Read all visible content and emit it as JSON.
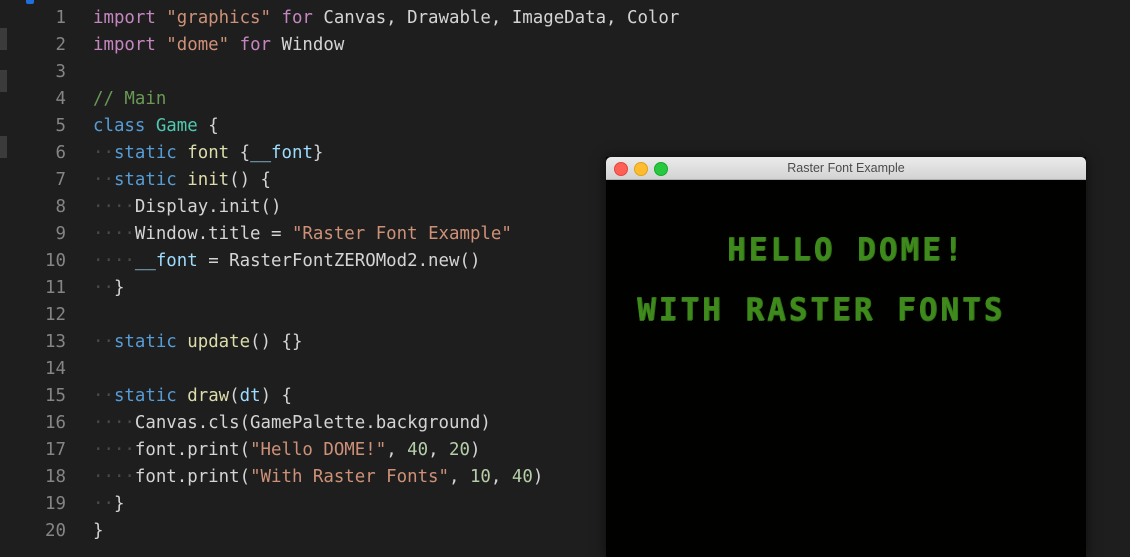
{
  "editor": {
    "lines": [
      {
        "num": "1",
        "tokens": [
          [
            "kw-import",
            "import "
          ],
          [
            "str",
            "\"graphics\""
          ],
          [
            "kw-import",
            " for "
          ],
          [
            "txt",
            "Canvas, Drawable, ImageData, Color"
          ]
        ]
      },
      {
        "num": "2",
        "tokens": [
          [
            "kw-import",
            "import "
          ],
          [
            "str",
            "\"dome\""
          ],
          [
            "kw-import",
            " for "
          ],
          [
            "txt",
            "Window"
          ]
        ]
      },
      {
        "num": "3",
        "tokens": []
      },
      {
        "num": "4",
        "tokens": [
          [
            "com",
            "// Main"
          ]
        ]
      },
      {
        "num": "5",
        "tokens": [
          [
            "kw",
            "class "
          ],
          [
            "cls",
            "Game"
          ],
          [
            "txt",
            " {"
          ]
        ]
      },
      {
        "num": "6",
        "tokens": [
          [
            "guide",
            "··"
          ],
          [
            "kw",
            "static "
          ],
          [
            "fn",
            "font"
          ],
          [
            "txt",
            " {"
          ],
          [
            "var",
            "__font"
          ],
          [
            "txt",
            "}"
          ]
        ]
      },
      {
        "num": "7",
        "tokens": [
          [
            "guide",
            "··"
          ],
          [
            "kw",
            "static "
          ],
          [
            "fn",
            "init"
          ],
          [
            "txt",
            "() {"
          ]
        ]
      },
      {
        "num": "8",
        "tokens": [
          [
            "guide",
            "····"
          ],
          [
            "txt",
            "Display.init()"
          ]
        ]
      },
      {
        "num": "9",
        "tokens": [
          [
            "guide",
            "····"
          ],
          [
            "txt",
            "Window.title = "
          ],
          [
            "str",
            "\"Raster Font Example\""
          ]
        ]
      },
      {
        "num": "10",
        "tokens": [
          [
            "guide",
            "····"
          ],
          [
            "var",
            "__font"
          ],
          [
            "txt",
            " = RasterFontZEROMod2.new()"
          ]
        ]
      },
      {
        "num": "11",
        "tokens": [
          [
            "guide",
            "··"
          ],
          [
            "txt",
            "}"
          ]
        ]
      },
      {
        "num": "12",
        "tokens": []
      },
      {
        "num": "13",
        "tokens": [
          [
            "guide",
            "··"
          ],
          [
            "kw",
            "static "
          ],
          [
            "fn",
            "update"
          ],
          [
            "txt",
            "() {}"
          ]
        ]
      },
      {
        "num": "14",
        "tokens": []
      },
      {
        "num": "15",
        "tokens": [
          [
            "guide",
            "··"
          ],
          [
            "kw",
            "static "
          ],
          [
            "fn",
            "draw"
          ],
          [
            "txt",
            "("
          ],
          [
            "var",
            "dt"
          ],
          [
            "txt",
            ") {"
          ]
        ]
      },
      {
        "num": "16",
        "tokens": [
          [
            "guide",
            "····"
          ],
          [
            "txt",
            "Canvas.cls(GamePalette.background)"
          ]
        ]
      },
      {
        "num": "17",
        "tokens": [
          [
            "guide",
            "····"
          ],
          [
            "txt",
            "font.print("
          ],
          [
            "str",
            "\"Hello DOME!\""
          ],
          [
            "txt",
            ", "
          ],
          [
            "num",
            "40"
          ],
          [
            "txt",
            ", "
          ],
          [
            "num",
            "20"
          ],
          [
            "txt",
            ")"
          ]
        ]
      },
      {
        "num": "18",
        "tokens": [
          [
            "guide",
            "····"
          ],
          [
            "txt",
            "font.print("
          ],
          [
            "str",
            "\"With Raster Fonts\""
          ],
          [
            "txt",
            ", "
          ],
          [
            "num",
            "10"
          ],
          [
            "txt",
            ", "
          ],
          [
            "num",
            "40"
          ],
          [
            "txt",
            ")"
          ]
        ]
      },
      {
        "num": "19",
        "tokens": [
          [
            "guide",
            "··"
          ],
          [
            "txt",
            "}"
          ]
        ]
      },
      {
        "num": "20",
        "tokens": [
          [
            "txt",
            "}"
          ]
        ]
      }
    ]
  },
  "window": {
    "title": "Raster Font Example",
    "lines": [
      "HELLO DOME!",
      "WITH RASTER FONTS"
    ],
    "text_color": "#3f8a1c"
  },
  "colors": {
    "editor_bg": "#1e1e1e",
    "keyword": "#569cd6",
    "string": "#ce9178",
    "function": "#dcdcaa"
  }
}
